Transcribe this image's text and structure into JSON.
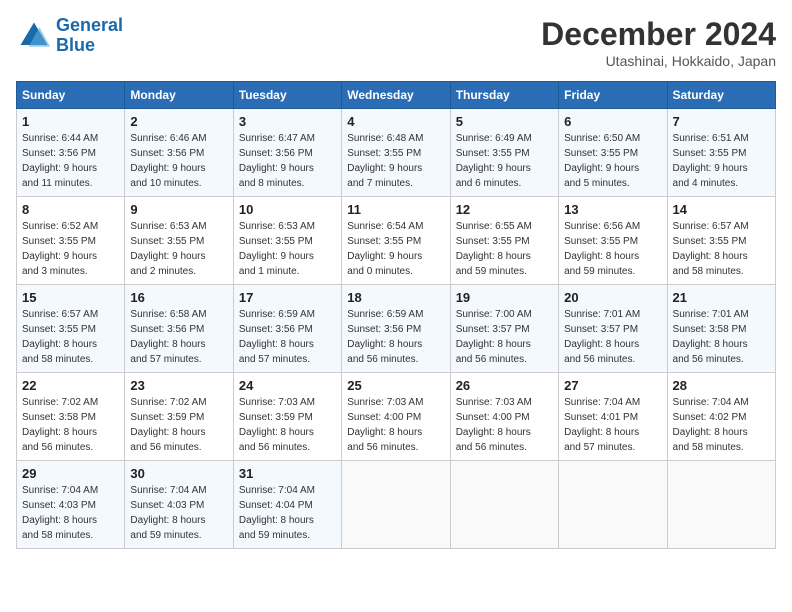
{
  "logo": {
    "line1": "General",
    "line2": "Blue"
  },
  "title": "December 2024",
  "subtitle": "Utashinai, Hokkaido, Japan",
  "days_header": [
    "Sunday",
    "Monday",
    "Tuesday",
    "Wednesday",
    "Thursday",
    "Friday",
    "Saturday"
  ],
  "weeks": [
    [
      {
        "num": "1",
        "info": "Sunrise: 6:44 AM\nSunset: 3:56 PM\nDaylight: 9 hours\nand 11 minutes."
      },
      {
        "num": "2",
        "info": "Sunrise: 6:46 AM\nSunset: 3:56 PM\nDaylight: 9 hours\nand 10 minutes."
      },
      {
        "num": "3",
        "info": "Sunrise: 6:47 AM\nSunset: 3:56 PM\nDaylight: 9 hours\nand 8 minutes."
      },
      {
        "num": "4",
        "info": "Sunrise: 6:48 AM\nSunset: 3:55 PM\nDaylight: 9 hours\nand 7 minutes."
      },
      {
        "num": "5",
        "info": "Sunrise: 6:49 AM\nSunset: 3:55 PM\nDaylight: 9 hours\nand 6 minutes."
      },
      {
        "num": "6",
        "info": "Sunrise: 6:50 AM\nSunset: 3:55 PM\nDaylight: 9 hours\nand 5 minutes."
      },
      {
        "num": "7",
        "info": "Sunrise: 6:51 AM\nSunset: 3:55 PM\nDaylight: 9 hours\nand 4 minutes."
      }
    ],
    [
      {
        "num": "8",
        "info": "Sunrise: 6:52 AM\nSunset: 3:55 PM\nDaylight: 9 hours\nand 3 minutes."
      },
      {
        "num": "9",
        "info": "Sunrise: 6:53 AM\nSunset: 3:55 PM\nDaylight: 9 hours\nand 2 minutes."
      },
      {
        "num": "10",
        "info": "Sunrise: 6:53 AM\nSunset: 3:55 PM\nDaylight: 9 hours\nand 1 minute."
      },
      {
        "num": "11",
        "info": "Sunrise: 6:54 AM\nSunset: 3:55 PM\nDaylight: 9 hours\nand 0 minutes."
      },
      {
        "num": "12",
        "info": "Sunrise: 6:55 AM\nSunset: 3:55 PM\nDaylight: 8 hours\nand 59 minutes."
      },
      {
        "num": "13",
        "info": "Sunrise: 6:56 AM\nSunset: 3:55 PM\nDaylight: 8 hours\nand 59 minutes."
      },
      {
        "num": "14",
        "info": "Sunrise: 6:57 AM\nSunset: 3:55 PM\nDaylight: 8 hours\nand 58 minutes."
      }
    ],
    [
      {
        "num": "15",
        "info": "Sunrise: 6:57 AM\nSunset: 3:55 PM\nDaylight: 8 hours\nand 58 minutes."
      },
      {
        "num": "16",
        "info": "Sunrise: 6:58 AM\nSunset: 3:56 PM\nDaylight: 8 hours\nand 57 minutes."
      },
      {
        "num": "17",
        "info": "Sunrise: 6:59 AM\nSunset: 3:56 PM\nDaylight: 8 hours\nand 57 minutes."
      },
      {
        "num": "18",
        "info": "Sunrise: 6:59 AM\nSunset: 3:56 PM\nDaylight: 8 hours\nand 56 minutes."
      },
      {
        "num": "19",
        "info": "Sunrise: 7:00 AM\nSunset: 3:57 PM\nDaylight: 8 hours\nand 56 minutes."
      },
      {
        "num": "20",
        "info": "Sunrise: 7:01 AM\nSunset: 3:57 PM\nDaylight: 8 hours\nand 56 minutes."
      },
      {
        "num": "21",
        "info": "Sunrise: 7:01 AM\nSunset: 3:58 PM\nDaylight: 8 hours\nand 56 minutes."
      }
    ],
    [
      {
        "num": "22",
        "info": "Sunrise: 7:02 AM\nSunset: 3:58 PM\nDaylight: 8 hours\nand 56 minutes."
      },
      {
        "num": "23",
        "info": "Sunrise: 7:02 AM\nSunset: 3:59 PM\nDaylight: 8 hours\nand 56 minutes."
      },
      {
        "num": "24",
        "info": "Sunrise: 7:03 AM\nSunset: 3:59 PM\nDaylight: 8 hours\nand 56 minutes."
      },
      {
        "num": "25",
        "info": "Sunrise: 7:03 AM\nSunset: 4:00 PM\nDaylight: 8 hours\nand 56 minutes."
      },
      {
        "num": "26",
        "info": "Sunrise: 7:03 AM\nSunset: 4:00 PM\nDaylight: 8 hours\nand 56 minutes."
      },
      {
        "num": "27",
        "info": "Sunrise: 7:04 AM\nSunset: 4:01 PM\nDaylight: 8 hours\nand 57 minutes."
      },
      {
        "num": "28",
        "info": "Sunrise: 7:04 AM\nSunset: 4:02 PM\nDaylight: 8 hours\nand 58 minutes."
      }
    ],
    [
      {
        "num": "29",
        "info": "Sunrise: 7:04 AM\nSunset: 4:03 PM\nDaylight: 8 hours\nand 58 minutes."
      },
      {
        "num": "30",
        "info": "Sunrise: 7:04 AM\nSunset: 4:03 PM\nDaylight: 8 hours\nand 59 minutes."
      },
      {
        "num": "31",
        "info": "Sunrise: 7:04 AM\nSunset: 4:04 PM\nDaylight: 8 hours\nand 59 minutes."
      },
      null,
      null,
      null,
      null
    ]
  ]
}
